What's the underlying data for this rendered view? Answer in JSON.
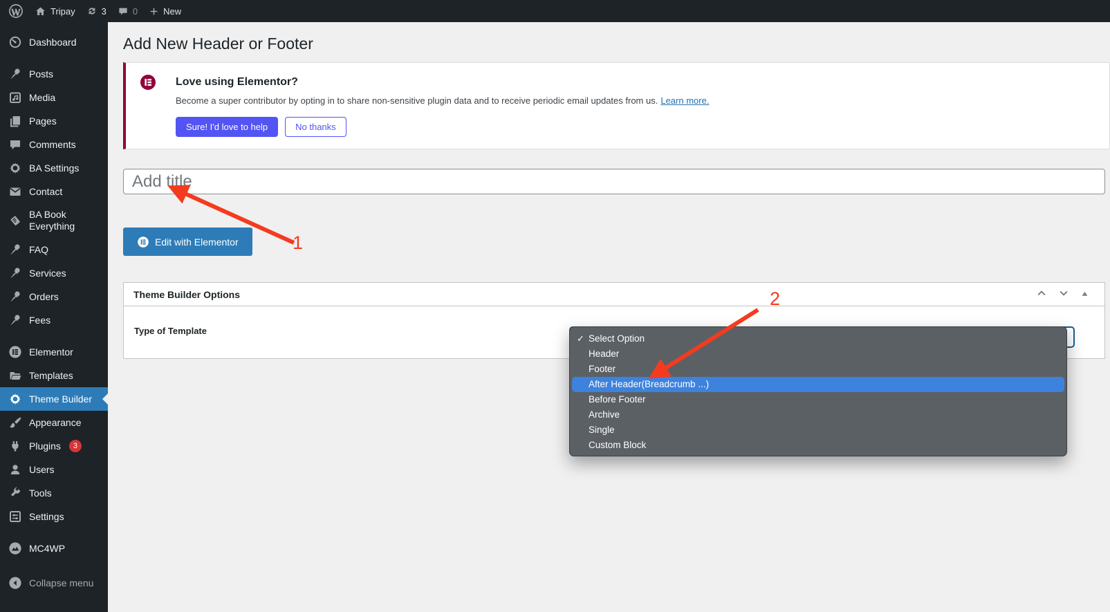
{
  "admin_bar": {
    "site_name": "Tripay",
    "update_count": "3",
    "comment_count": "0",
    "new_label": "New"
  },
  "sidebar": {
    "items": [
      {
        "label": "Dashboard",
        "icon": "dashboard-icon"
      },
      {
        "label": "Posts",
        "icon": "pushpin-icon"
      },
      {
        "label": "Media",
        "icon": "media-icon"
      },
      {
        "label": "Pages",
        "icon": "pages-icon"
      },
      {
        "label": "Comments",
        "icon": "comments-icon"
      },
      {
        "label": "BA Settings",
        "icon": "gear-icon"
      },
      {
        "label": "Contact",
        "icon": "envelope-icon"
      },
      {
        "label": "BA Book Everything",
        "icon": "book-icon"
      },
      {
        "label": "FAQ",
        "icon": "pushpin-icon"
      },
      {
        "label": "Services",
        "icon": "pushpin-icon"
      },
      {
        "label": "Orders",
        "icon": "pushpin-icon"
      },
      {
        "label": "Fees",
        "icon": "pushpin-icon"
      },
      {
        "label": "Elementor",
        "icon": "elementor-icon"
      },
      {
        "label": "Templates",
        "icon": "folder-icon"
      },
      {
        "label": "Theme Builder",
        "icon": "gear-icon",
        "active": true
      },
      {
        "label": "Appearance",
        "icon": "brush-icon"
      },
      {
        "label": "Plugins",
        "icon": "plug-icon",
        "badge": "3"
      },
      {
        "label": "Users",
        "icon": "user-icon"
      },
      {
        "label": "Tools",
        "icon": "wrench-icon"
      },
      {
        "label": "Settings",
        "icon": "sliders-icon"
      },
      {
        "label": "MC4WP",
        "icon": "mc4wp-icon"
      }
    ],
    "collapse_label": "Collapse menu"
  },
  "main": {
    "page_title": "Add New Header or Footer",
    "notice": {
      "title": "Love using Elementor?",
      "body": "Become a super contributor by opting in to share non-sensitive plugin data and to receive periodic email updates from us.",
      "link_label": "Learn more.",
      "accept_label": "Sure! I'd love to help",
      "decline_label": "No thanks"
    },
    "title_placeholder": "Add title",
    "edit_button_label": "Edit with Elementor",
    "metabox": {
      "title": "Theme Builder Options",
      "field_label": "Type of Template"
    },
    "dropdown": {
      "options": [
        "Select Option",
        "Header",
        "Footer",
        "After Header(Breadcrumb ...)",
        "Before Footer",
        "Archive",
        "Single",
        "Custom Block"
      ],
      "selected_option": "Select Option",
      "highlighted_option": "After Header(Breadcrumb ...)"
    },
    "annotations": {
      "step1": "1",
      "step2": "2"
    }
  },
  "colors": {
    "admin_dark": "#1d2327",
    "active_blue": "#2d7cb7",
    "elementor_magenta": "#93003c",
    "elementor_purple": "#5254f3",
    "link_blue": "#2271b1",
    "dropdown_gray": "#5b6065",
    "dropdown_highlight": "#3d82dd",
    "select_focus_border": "#135e96",
    "badge_red": "#d63638",
    "annotation_red": "#f43b1f"
  }
}
